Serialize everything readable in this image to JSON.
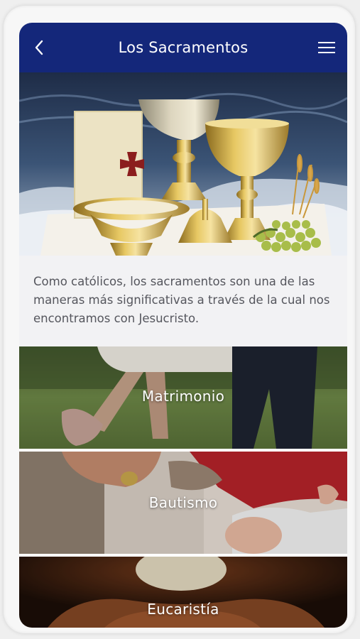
{
  "header": {
    "title": "Los Sacramentos",
    "back_icon": "chevron-left-icon",
    "menu_icon": "hamburger-menu-icon",
    "background_color": "#14277a"
  },
  "intro": {
    "text": "Como católicos, los sacramentos son una de las maneras más significativas a través de la cual nos encontramos con Jesucristo."
  },
  "sacraments": [
    {
      "label": "Matrimonio"
    },
    {
      "label": "Bautismo"
    },
    {
      "label": "Eucaristía"
    }
  ]
}
